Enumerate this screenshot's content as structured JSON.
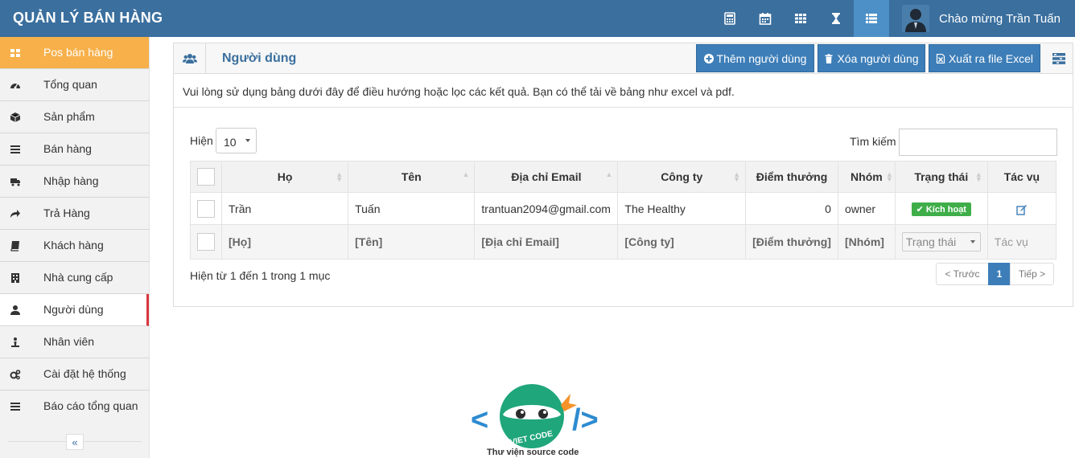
{
  "app": {
    "brand": "QUẢN LÝ BÁN HÀNG",
    "greeting": "Chào mừng Trần Tuấn",
    "top_icons": [
      "calculator-icon",
      "calendar-icon",
      "grid-icon",
      "hourglass-icon",
      "list-icon"
    ]
  },
  "sidebar": {
    "items": [
      {
        "label": "Pos bán hàng",
        "icon": "pos-icon"
      },
      {
        "label": "Tổng quan",
        "icon": "dashboard-icon"
      },
      {
        "label": "Sản phẩm",
        "icon": "cube-icon"
      },
      {
        "label": "Bán hàng",
        "icon": "bars-icon"
      },
      {
        "label": "Nhập hàng",
        "icon": "truck-icon"
      },
      {
        "label": "Trả Hàng",
        "icon": "share-icon"
      },
      {
        "label": "Khách hàng",
        "icon": "book-icon"
      },
      {
        "label": "Nhà cung cấp",
        "icon": "building-icon"
      },
      {
        "label": "Người dùng",
        "icon": "user-icon"
      },
      {
        "label": "Nhân viên",
        "icon": "staff-icon"
      },
      {
        "label": "Cài đặt hệ thống",
        "icon": "gears-icon"
      },
      {
        "label": "Báo cáo tổng quan",
        "icon": "bars-icon"
      }
    ],
    "collapse": "«"
  },
  "panel": {
    "title": "Người dùng",
    "buttons": {
      "add": "Thêm người dùng",
      "delete": "Xóa người dùng",
      "export": "Xuất ra file Excel"
    },
    "info": "Vui lòng sử dụng bảng dưới đây để điều hướng hoặc lọc các kết quả. Bạn có thể tải về bảng như excel và pdf.",
    "length_label": "Hiện",
    "length_value": "10",
    "search_label": "Tìm kiếm",
    "search_value": ""
  },
  "table": {
    "columns": [
      "Họ",
      "Tên",
      "Địa chỉ Email",
      "Công ty",
      "Điểm thưởng",
      "Nhóm",
      "Trạng thái",
      "Tác vụ"
    ],
    "rows": [
      {
        "last": "Trần",
        "first": "Tuấn",
        "email": "trantuan2094@gmail.com",
        "company": "The Healthy",
        "points": "0",
        "group": "owner",
        "status": "Kích hoạt"
      }
    ],
    "filters": [
      "[Họ]",
      "[Tên]",
      "[Địa chỉ Email]",
      "[Công ty]",
      "[Điểm thưởng]",
      "[Nhóm]",
      "Trạng thái",
      "Tác vụ"
    ]
  },
  "footer": {
    "summary": "Hiện từ 1 đến 1 trong 1 mục",
    "prev": "< Trước",
    "current_page": "1",
    "next": "Tiếp >"
  },
  "logo": {
    "text": "VIET CODE",
    "caption": "Thư viện source code"
  },
  "colors": {
    "header": "#3a6f9e",
    "accent": "#3d7eb8",
    "sidebar_active": "#f7b04a",
    "badge_green": "#3fae49"
  }
}
